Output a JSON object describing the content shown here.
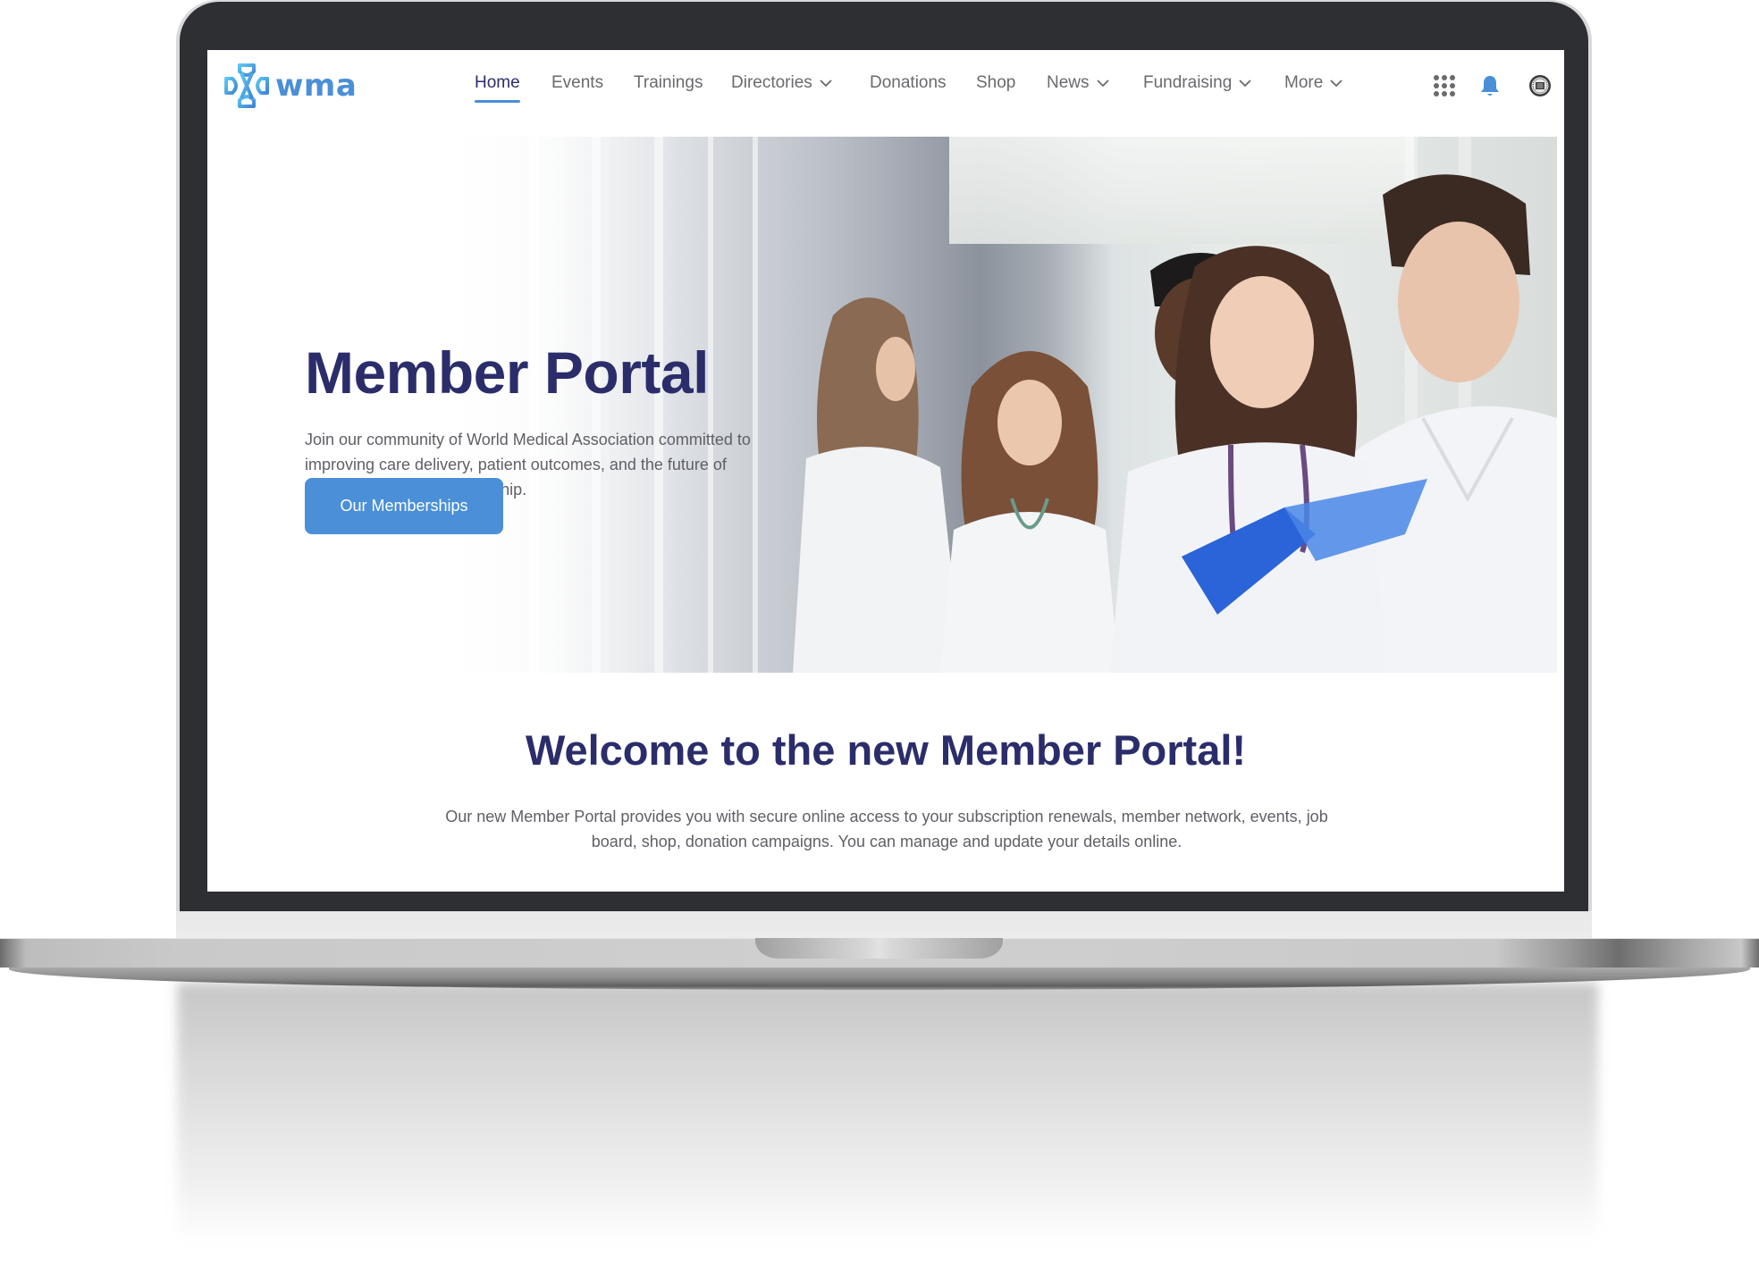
{
  "brand": {
    "name": "wma",
    "accent_color": "#4a8fd8",
    "heading_color": "#2b2d6b"
  },
  "nav": {
    "items": [
      {
        "label": "Home",
        "active": true,
        "dropdown": false
      },
      {
        "label": "Events",
        "active": false,
        "dropdown": false
      },
      {
        "label": "Trainings",
        "active": false,
        "dropdown": false
      },
      {
        "label": "Directories",
        "active": false,
        "dropdown": true
      },
      {
        "label": "Donations",
        "active": false,
        "dropdown": false
      },
      {
        "label": "Shop",
        "active": false,
        "dropdown": false
      },
      {
        "label": "News",
        "active": false,
        "dropdown": true
      },
      {
        "label": "Fundraising",
        "active": false,
        "dropdown": true
      },
      {
        "label": "More",
        "active": false,
        "dropdown": true
      }
    ],
    "utility_icons": [
      "apps-grid-icon",
      "notification-bell-icon",
      "user-avatar-icon"
    ]
  },
  "hero": {
    "title": "Member Portal",
    "description": "Join our community of World Medical Association committed to improving care delivery, patient outcomes, and the future of health care through leadership.",
    "button_label": "Our Memberships",
    "image_alt": "Group of medical professionals in white coats reviewing a blue folder in a hospital corridor"
  },
  "welcome": {
    "title": "Welcome to the new Member Portal!",
    "text": "Our new Member Portal provides you with secure online access to your subscription renewals, member network, events, job board, shop, donation campaigns. You can manage and update your details online."
  }
}
